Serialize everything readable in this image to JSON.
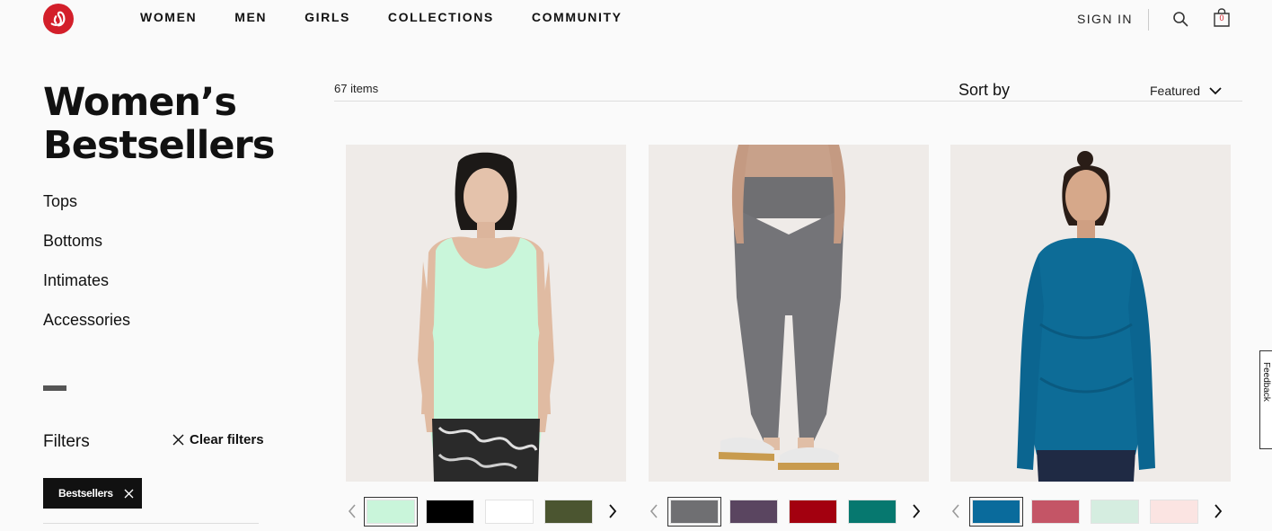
{
  "header": {
    "nav": [
      "WOMEN",
      "MEN",
      "GIRLS",
      "COLLECTIONS",
      "COMMUNITY"
    ],
    "sign_in": "SIGN IN",
    "bag_count": "0",
    "brand_color": "#d31f2a"
  },
  "sidebar": {
    "title": "Women’s Bestsellers",
    "categories": [
      "Tops",
      "Bottoms",
      "Intimates",
      "Accessories"
    ],
    "filters_label": "Filters",
    "clear_filters": "Clear filters",
    "active_filter": "Bestsellers"
  },
  "results": {
    "count": "67 items",
    "sort_label": "Sort by",
    "sort_value": "Featured"
  },
  "products": [
    {
      "image": "tank-top-mint",
      "swatches": [
        "#c9f5da",
        "#000000",
        "#ffffff",
        "#4b5530"
      ],
      "selected": 0
    },
    {
      "image": "leggings-grey",
      "swatches": [
        "#6f6f72",
        "#5a4560",
        "#a3000f",
        "#06786f"
      ],
      "selected": 0
    },
    {
      "image": "long-sleeve-teal",
      "swatches": [
        "#0a6b9c",
        "#c45566",
        "#d5ede0",
        "#fbe4e2"
      ],
      "selected": 0
    }
  ],
  "feedback": "Feedback"
}
